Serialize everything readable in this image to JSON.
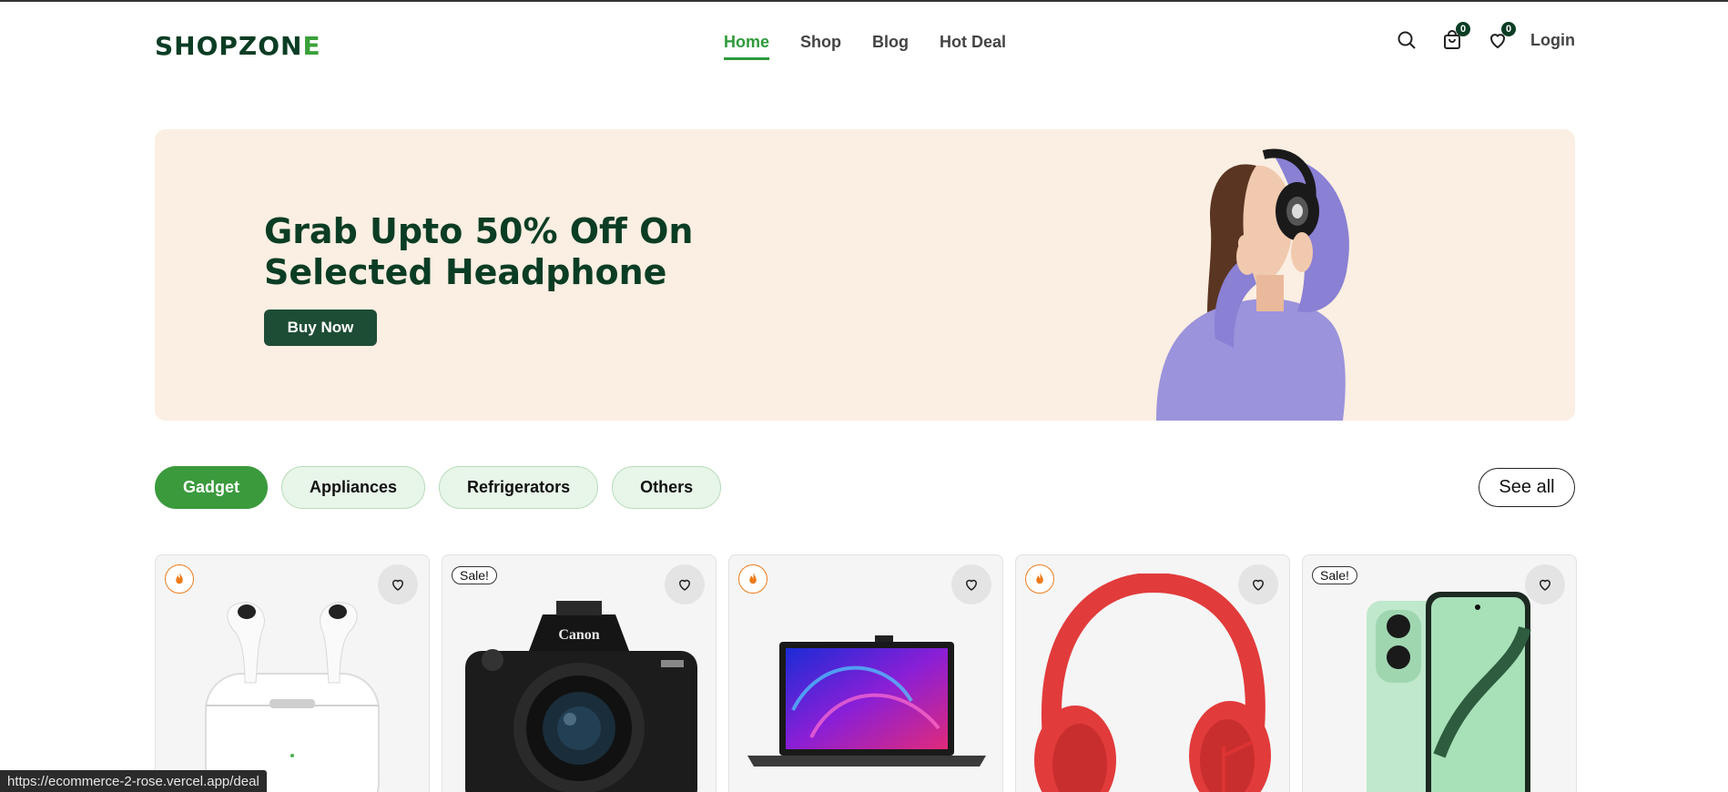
{
  "header": {
    "logo_main": "SHOPZON",
    "logo_last": "E",
    "nav": [
      "Home",
      "Shop",
      "Blog",
      "Hot Deal"
    ],
    "active_nav": "Home",
    "cart_count": "0",
    "wishlist_count": "0",
    "login_label": "Login"
  },
  "hero": {
    "title_line1": "Grab Upto 50% Off On",
    "title_line2": "Selected Headphone",
    "button_label": "Buy Now",
    "background": "#fbeee2"
  },
  "categories": {
    "items": [
      "Gadget",
      "Appliances",
      "Refrigerators",
      "Others"
    ],
    "active": "Gadget",
    "see_all_label": "See all"
  },
  "products": [
    {
      "badge": "fire",
      "image": "airpods"
    },
    {
      "badge": "Sale!",
      "image": "canon-camera"
    },
    {
      "badge": "fire",
      "image": "laptop"
    },
    {
      "badge": "fire",
      "image": "red-headphones"
    },
    {
      "badge": "Sale!",
      "image": "green-smartphone"
    }
  ],
  "status_bar": {
    "url": "https://ecommerce-2-rose.vercel.app/deal"
  },
  "colors": {
    "brand_dark": "#0b3d24",
    "accent_green": "#3a9a3c",
    "fire_orange": "#f07b1a"
  }
}
